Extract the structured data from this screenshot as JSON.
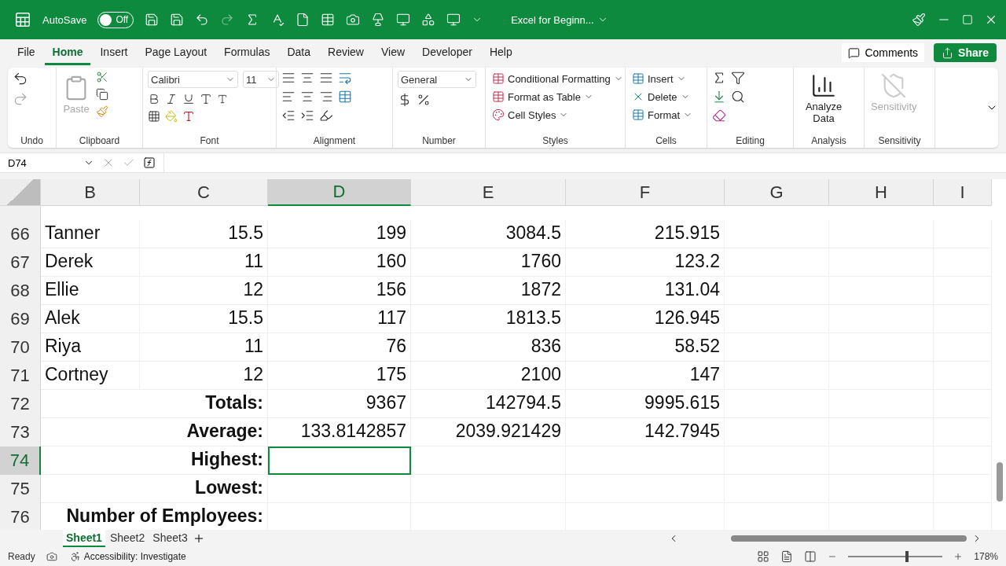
{
  "title_bar": {
    "autosave_label": "AutoSave",
    "autosave_on": false,
    "toggle_label": "Off",
    "document_title": "Excel for Beginn..."
  },
  "menu_tabs": [
    {
      "label": "File",
      "selected": false
    },
    {
      "label": "Home",
      "selected": true
    },
    {
      "label": "Insert",
      "selected": false
    },
    {
      "label": "Page Layout",
      "selected": false
    },
    {
      "label": "Formulas",
      "selected": false
    },
    {
      "label": "Data",
      "selected": false
    },
    {
      "label": "Review",
      "selected": false
    },
    {
      "label": "View",
      "selected": false
    },
    {
      "label": "Developer",
      "selected": false
    },
    {
      "label": "Help",
      "selected": false
    }
  ],
  "comments_button": "Comments",
  "share_button": "Share",
  "ribbon": [
    {
      "kind": "undo",
      "label": "Undo"
    },
    {
      "kind": "clipboard",
      "label": "Clipboard",
      "paste": "Paste"
    },
    {
      "kind": "font",
      "label": "Font",
      "font_name": "Calibri",
      "font_size": "11"
    },
    {
      "kind": "alignment",
      "label": "Alignment"
    },
    {
      "kind": "number",
      "label": "Number",
      "format": "General"
    },
    {
      "kind": "styles",
      "label": "Styles",
      "items": [
        "Conditional Formatting",
        "Format as Table",
        "Cell Styles"
      ]
    },
    {
      "kind": "cells",
      "label": "Cells",
      "items": [
        "Insert",
        "Delete",
        "Format"
      ]
    },
    {
      "kind": "editing",
      "label": "Editing"
    },
    {
      "kind": "analysis",
      "label": "Analysis",
      "button": "Analyze Data"
    },
    {
      "kind": "sensitivity",
      "label": "Sensitivity",
      "button": "Sensitivity",
      "disabled": true
    }
  ],
  "name_box": "D74",
  "columns": [
    {
      "label": "B",
      "selected": false
    },
    {
      "label": "C",
      "selected": false
    },
    {
      "label": "D",
      "selected": true
    },
    {
      "label": "E",
      "selected": false
    },
    {
      "label": "F",
      "selected": false
    },
    {
      "label": "G",
      "selected": false
    },
    {
      "label": "H",
      "selected": false
    },
    {
      "label": "I",
      "selected": false
    }
  ],
  "rows": [
    {
      "number": "66",
      "kind": "data",
      "selected": false,
      "cells": [
        "Tanner",
        "15.5",
        "199",
        "3084.5",
        "215.915"
      ]
    },
    {
      "number": "67",
      "kind": "data",
      "selected": false,
      "cells": [
        "Derek",
        "11",
        "160",
        "1760",
        "123.2"
      ]
    },
    {
      "number": "68",
      "kind": "data",
      "selected": false,
      "cells": [
        "Ellie",
        "12",
        "156",
        "1872",
        "131.04"
      ]
    },
    {
      "number": "69",
      "kind": "data",
      "selected": false,
      "cells": [
        "Alek",
        "15.5",
        "117",
        "1813.5",
        "126.945"
      ]
    },
    {
      "number": "70",
      "kind": "data",
      "selected": false,
      "cells": [
        "Riya",
        "11",
        "76",
        "836",
        "58.52"
      ]
    },
    {
      "number": "71",
      "kind": "data",
      "selected": false,
      "cells": [
        "Cortney",
        "12",
        "175",
        "2100",
        "147"
      ]
    },
    {
      "number": "72",
      "kind": "summary",
      "selected": false,
      "label": "Totals:",
      "cells": [
        "9367",
        "142794.5",
        "9995.615"
      ]
    },
    {
      "number": "73",
      "kind": "summary",
      "selected": false,
      "label": "Average:",
      "cells": [
        "133.8142857",
        "2039.921429",
        "142.7945"
      ]
    },
    {
      "number": "74",
      "kind": "summary",
      "selected": true,
      "label": "Highest:"
    },
    {
      "number": "75",
      "kind": "summary",
      "selected": false,
      "label": "Lowest:"
    },
    {
      "number": "76",
      "kind": "summary",
      "selected": false,
      "label": "Number of Employees:"
    }
  ],
  "sheets": [
    {
      "label": "Sheet1",
      "selected": true
    },
    {
      "label": "Sheet2",
      "selected": false
    },
    {
      "label": "Sheet3",
      "selected": false
    }
  ],
  "status_bar": {
    "ready": "Ready",
    "accessibility": "Accessibility: Investigate",
    "zoom": "178%",
    "level": 0.62
  }
}
